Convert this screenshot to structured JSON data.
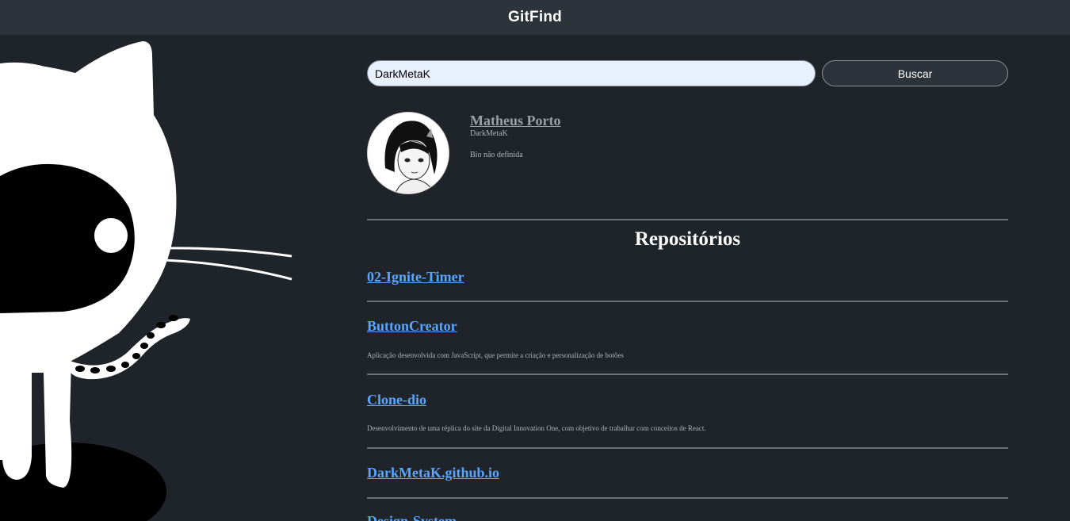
{
  "header": {
    "title": "GitFind"
  },
  "search": {
    "value": "DarkMetaK",
    "button_label": "Buscar"
  },
  "profile": {
    "name": "Matheus Porto",
    "login": "DarkMetaK",
    "bio": "Bio não definida"
  },
  "repos": {
    "heading": "Repositórios",
    "items": [
      {
        "name": "02-Ignite-Timer",
        "description": ""
      },
      {
        "name": "ButtonCreator",
        "description": "Aplicação desenvolvida com JavaScript, que permite a criação e personalização de botões"
      },
      {
        "name": "Clone-dio",
        "description": "Desenvolvimento de uma réplica do site da Digital Innovation One, com objetivo de trabalhar com conceitos de React."
      },
      {
        "name": "DarkMetaK.github.io",
        "description": ""
      },
      {
        "name": "Design-System",
        "description": ""
      }
    ]
  },
  "colors": {
    "topbar": "#2d333b",
    "background": "#1f232a",
    "link": "#58a6ff",
    "text_muted": "#b0b5bb"
  },
  "icons": {
    "hero": "octocat-illustration",
    "avatar": "anime-avatar-image"
  }
}
